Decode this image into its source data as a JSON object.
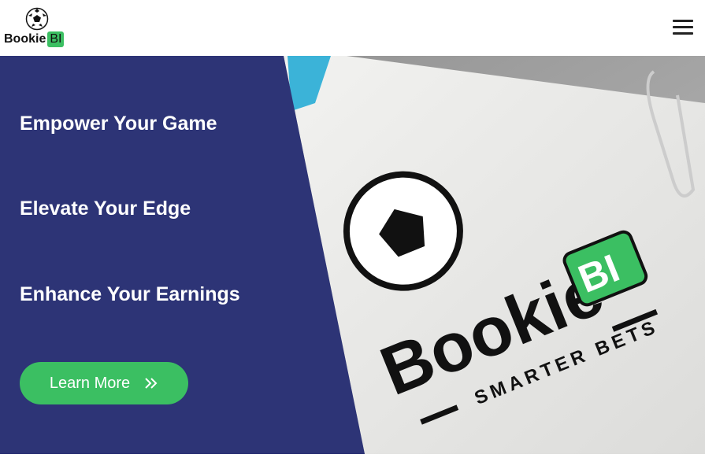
{
  "header": {
    "logo_text": "Bookie",
    "logo_badge": "BI"
  },
  "hero": {
    "taglines": [
      "Empower Your Game",
      "Elevate Your Edge",
      "Enhance Your Earnings"
    ],
    "button_label": "Learn More",
    "image_text": {
      "brand": "Bookie",
      "badge": "BI",
      "slogan": "SMARTER BETS"
    }
  },
  "colors": {
    "panel": "#2d3476",
    "accent": "#3bbf62"
  }
}
